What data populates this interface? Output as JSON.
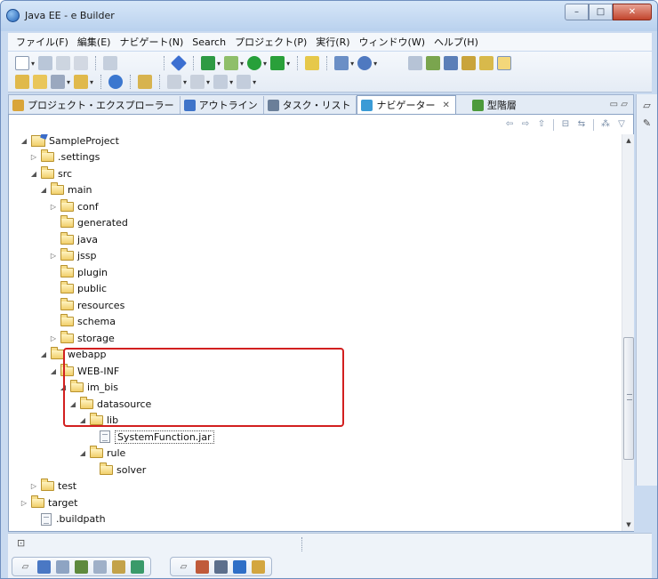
{
  "window": {
    "title": "Java EE - e Builder",
    "minimize_glyph": "–",
    "maximize_glyph": "□",
    "close_glyph": "✕"
  },
  "menu": [
    "ファイル(F)",
    "編集(E)",
    "ナビゲート(N)",
    "Search",
    "プロジェクト(P)",
    "実行(R)",
    "ウィンドウ(W)",
    "ヘルプ(H)"
  ],
  "tabs": [
    {
      "label": "プロジェクト・エクスプローラー",
      "icon": "project-explorer-icon",
      "color": "#d9a53a"
    },
    {
      "label": "アウトライン",
      "icon": "outline-icon",
      "color": "#3f74c9"
    },
    {
      "label": "タスク・リスト",
      "icon": "task-list-icon",
      "color": "#6b7f99"
    },
    {
      "label": "ナビゲーター",
      "icon": "navigator-icon",
      "color": "#3b9bd6",
      "active": true,
      "close": "✕"
    },
    {
      "label": "型階層",
      "icon": "type-hierarchy-icon",
      "color": "#4c9a3b"
    }
  ],
  "tree": [
    {
      "label": "SampleProject",
      "level": 0,
      "expanded": true,
      "type": "project"
    },
    {
      "label": ".settings",
      "level": 1,
      "expanded": false,
      "type": "folder"
    },
    {
      "label": "src",
      "level": 1,
      "expanded": true,
      "type": "folder"
    },
    {
      "label": "main",
      "level": 2,
      "expanded": true,
      "type": "folder"
    },
    {
      "label": "conf",
      "level": 3,
      "expanded": false,
      "type": "folder"
    },
    {
      "label": "generated",
      "level": 3,
      "type": "folder"
    },
    {
      "label": "java",
      "level": 3,
      "type": "folder"
    },
    {
      "label": "jssp",
      "level": 3,
      "expanded": false,
      "type": "folder"
    },
    {
      "label": "plugin",
      "level": 3,
      "type": "folder"
    },
    {
      "label": "public",
      "level": 3,
      "type": "folder"
    },
    {
      "label": "resources",
      "level": 3,
      "type": "folder"
    },
    {
      "label": "schema",
      "level": 3,
      "type": "folder"
    },
    {
      "label": "storage",
      "level": 3,
      "expanded": false,
      "type": "folder"
    },
    {
      "label": "webapp",
      "level": 2,
      "expanded": true,
      "type": "folder"
    },
    {
      "label": "WEB-INF",
      "level": 3,
      "expanded": true,
      "type": "folder"
    },
    {
      "label": "im_bis",
      "level": 4,
      "expanded": true,
      "type": "folder"
    },
    {
      "label": "datasource",
      "level": 5,
      "expanded": true,
      "type": "folder"
    },
    {
      "label": "lib",
      "level": 6,
      "expanded": true,
      "type": "folder"
    },
    {
      "label": "SystemFunction.jar",
      "level": 7,
      "type": "file",
      "boxed": true
    },
    {
      "label": "rule",
      "level": 6,
      "expanded": true,
      "type": "folder"
    },
    {
      "label": "solver",
      "level": 7,
      "type": "folder"
    },
    {
      "label": "test",
      "level": 1,
      "expanded": false,
      "type": "folder"
    },
    {
      "label": "target",
      "level": 0,
      "expanded": false,
      "type": "folder"
    },
    {
      "label": ".buildpath",
      "level": 1,
      "type": "file"
    }
  ],
  "glyphs": {
    "expanded": "◢",
    "collapsed": "▷",
    "scroll_up": "▲",
    "scroll_down": "▼"
  }
}
